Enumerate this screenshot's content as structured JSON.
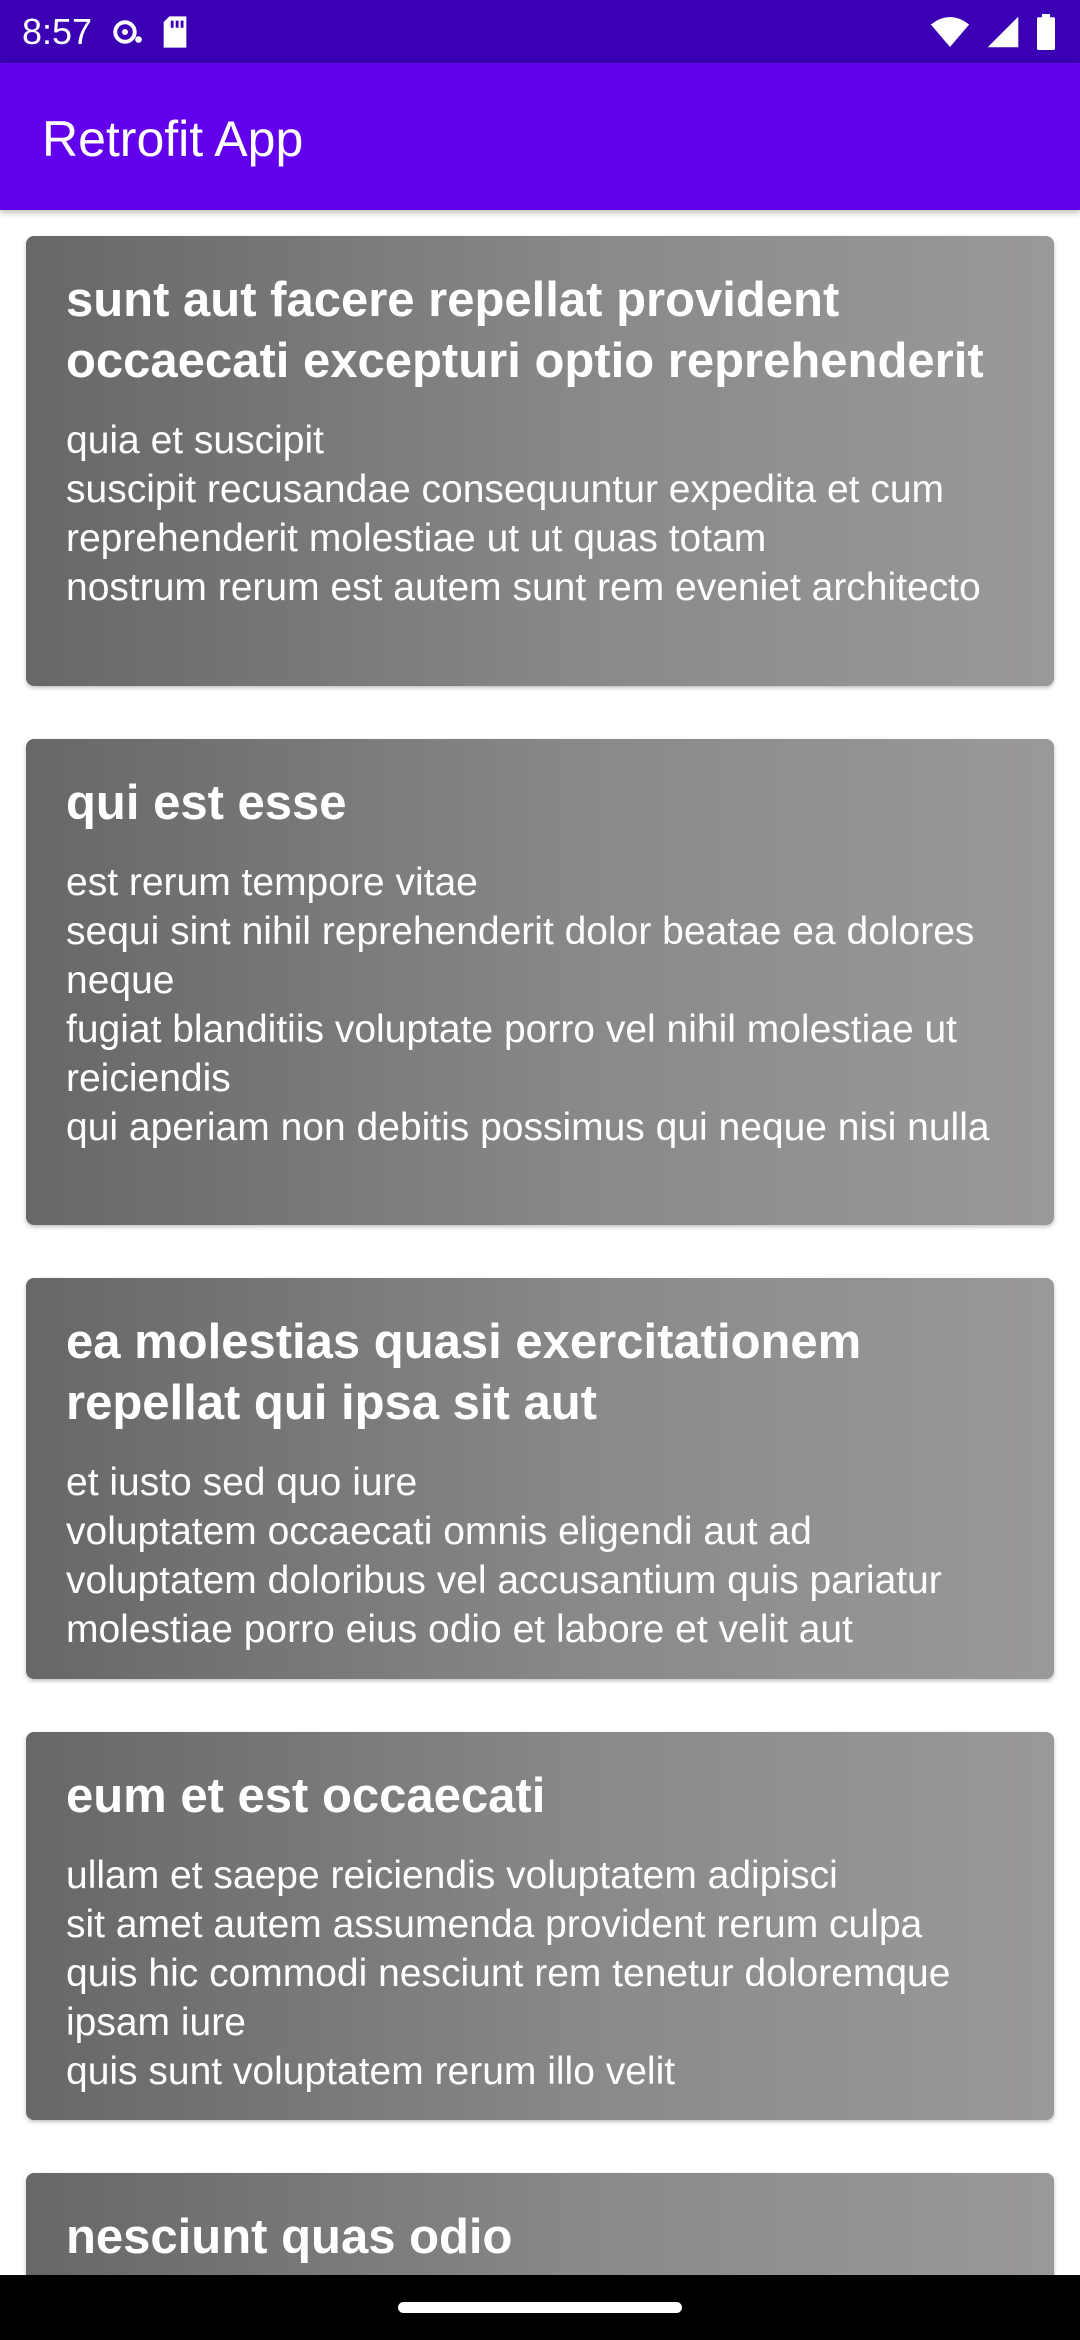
{
  "status_bar": {
    "time": "8:57",
    "icons_left": [
      "sync-icon",
      "sd-card-icon"
    ],
    "icons_right": [
      "wifi-icon",
      "signal-icon",
      "battery-icon"
    ],
    "color": "#3b00b3"
  },
  "app_bar": {
    "title": "Retrofit App",
    "color": "#6200ee"
  },
  "posts": [
    {
      "title": "sunt aut facere repellat provident occaecati excepturi optio reprehenderit",
      "body": "quia et suscipit\nsuscipit recusandae consequuntur expedita et cum reprehenderit molestiae ut ut quas totam\nnostrum rerum est autem sunt rem eveniet architecto"
    },
    {
      "title": "qui est esse",
      "body": "est rerum tempore vitae\nsequi sint nihil reprehenderit dolor beatae ea dolores neque\nfugiat blanditiis voluptate porro vel nihil molestiae ut reiciendis\nqui aperiam non debitis possimus qui neque nisi nulla"
    },
    {
      "title": "ea molestias quasi exercitationem repellat qui ipsa sit aut",
      "body": "et iusto sed quo iure\nvoluptatem occaecati omnis eligendi aut ad\nvoluptatem doloribus vel accusantium quis pariatur\nmolestiae porro eius odio et labore et velit aut"
    },
    {
      "title": "eum et est occaecati",
      "body": "ullam et saepe reiciendis voluptatem adipisci\nsit amet autem assumenda provident rerum culpa\nquis hic commodi nesciunt rem tenetur doloremque ipsam iure\nquis sunt voluptatem rerum illo velit"
    },
    {
      "title": "nesciunt quas odio",
      "body": ""
    }
  ],
  "nav_bar": {
    "handle": "home-handle"
  }
}
